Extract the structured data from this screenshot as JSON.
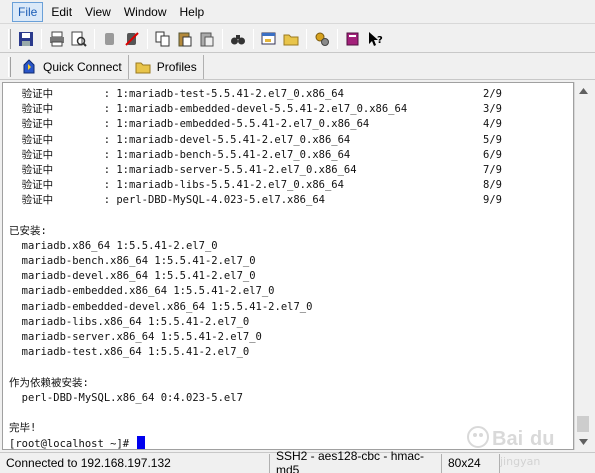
{
  "menu": {
    "items": [
      "File",
      "Edit",
      "View",
      "Window",
      "Help"
    ]
  },
  "toolbar": {
    "icons": [
      "save-icon",
      "print-icon",
      "print-preview-icon",
      "disconnect-icon",
      "connect-icon",
      "copy-icon",
      "paste-icon",
      "paste-special-icon",
      "find-icon",
      "sftp-icon",
      "folder-icon",
      "settings-icon",
      "profiles-book-icon",
      "help-cursor-icon"
    ]
  },
  "quickbar": {
    "quick_connect": "Quick Connect",
    "profiles": "Profiles"
  },
  "terminal": {
    "lines": [
      "  验证中        : 1:mariadb-test-5.5.41-2.el7_0.x86_64                      2/9",
      "  验证中        : 1:mariadb-embedded-devel-5.5.41-2.el7_0.x86_64            3/9",
      "  验证中        : 1:mariadb-embedded-5.5.41-2.el7_0.x86_64                  4/9",
      "  验证中        : 1:mariadb-devel-5.5.41-2.el7_0.x86_64                     5/9",
      "  验证中        : 1:mariadb-bench-5.5.41-2.el7_0.x86_64                     6/9",
      "  验证中        : 1:mariadb-server-5.5.41-2.el7_0.x86_64                    7/9",
      "  验证中        : 1:mariadb-libs-5.5.41-2.el7_0.x86_64                      8/9",
      "  验证中        : perl-DBD-MySQL-4.023-5.el7.x86_64                         9/9",
      "",
      "已安装:",
      "  mariadb.x86_64 1:5.5.41-2.el7_0",
      "  mariadb-bench.x86_64 1:5.5.41-2.el7_0",
      "  mariadb-devel.x86_64 1:5.5.41-2.el7_0",
      "  mariadb-embedded.x86_64 1:5.5.41-2.el7_0",
      "  mariadb-embedded-devel.x86_64 1:5.5.41-2.el7_0",
      "  mariadb-libs.x86_64 1:5.5.41-2.el7_0",
      "  mariadb-server.x86_64 1:5.5.41-2.el7_0",
      "  mariadb-test.x86_64 1:5.5.41-2.el7_0",
      "",
      "作为依赖被安装:",
      "  perl-DBD-MySQL.x86_64 0:4.023-5.el7",
      "",
      "完毕!"
    ],
    "prompt": "[root@localhost ~]# "
  },
  "status": {
    "connection": "Connected to 192.168.197.132",
    "cipher": "SSH2 - aes128-cbc - hmac-md5",
    "size": "80x24"
  },
  "colors": {
    "cursor": "#0000ee",
    "menu_active": "#1a5cb5"
  }
}
